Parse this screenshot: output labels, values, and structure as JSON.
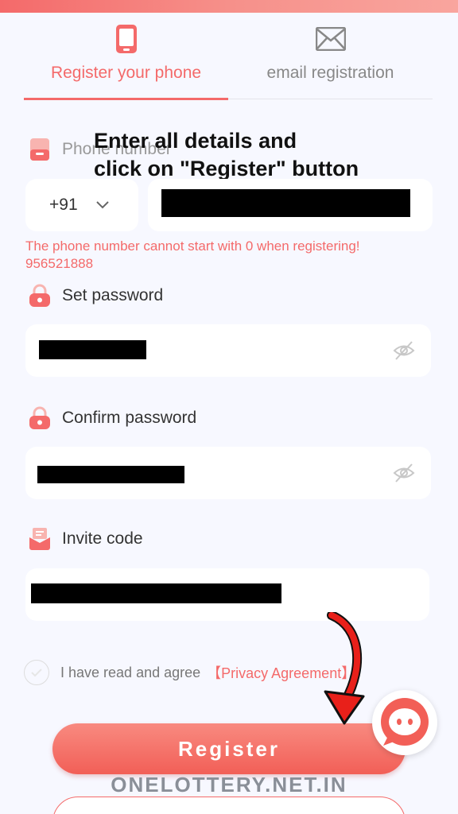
{
  "tabs": {
    "phone_label": "Register your phone",
    "email_label": "email registration"
  },
  "overlay": {
    "line1": "Enter all details and",
    "line2": "click on \"Register\" button"
  },
  "phone": {
    "label": "Phone number",
    "country_code": "+91",
    "error_line1": "The phone number cannot start with 0 when registering!",
    "error_line2": "956521888"
  },
  "password": {
    "label": "Set password"
  },
  "confirm": {
    "label": "Confirm password"
  },
  "invite": {
    "label": "Invite code"
  },
  "agreement": {
    "text": "I have read and agree",
    "link": "【Privacy Agreement】"
  },
  "register_button": "Register",
  "watermark": "ONELOTTERY.NET.IN",
  "colors": {
    "accent": "#f46a6a",
    "background": "#f7f8ff"
  }
}
